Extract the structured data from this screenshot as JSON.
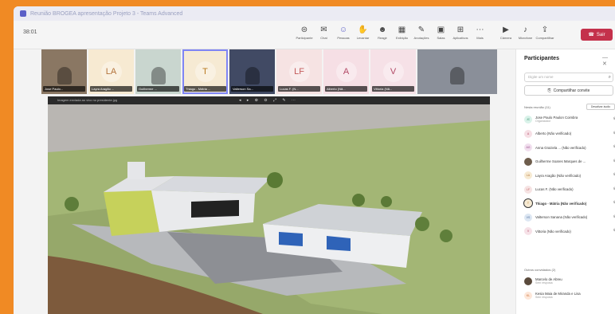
{
  "window": {
    "title": "Reunião BROGEA apresentação Projeto 3 - Teams Advanced"
  },
  "toolbar": {
    "timer": "38:01",
    "buttons": [
      {
        "label": "Participante",
        "icon": "participants-icon"
      },
      {
        "label": "Chat",
        "icon": "chat-icon"
      },
      {
        "label": "Pessoas",
        "icon": "people-icon"
      },
      {
        "label": "Levantar",
        "icon": "raise-hand-icon"
      },
      {
        "label": "Reagir",
        "icon": "react-icon"
      },
      {
        "label": "Exibição",
        "icon": "view-icon"
      },
      {
        "label": "Anotações",
        "icon": "notes-icon"
      },
      {
        "label": "Salas",
        "icon": "rooms-icon"
      },
      {
        "label": "Aplicativos",
        "icon": "apps-icon"
      },
      {
        "label": "Mais",
        "icon": "more-icon"
      },
      {
        "label": "Câmera",
        "icon": "camera-icon"
      },
      {
        "label": "Microfone",
        "icon": "mic-icon"
      },
      {
        "label": "Compartilhar",
        "icon": "share-icon"
      }
    ],
    "leave_label": "Sair"
  },
  "tiles": [
    {
      "name": "Jose Paulo...",
      "initials": "",
      "bg": "#8a7763",
      "color": "#333",
      "wide": false
    },
    {
      "name": "Layra Aragão ...",
      "initials": "LA",
      "bg": "#f7ead2",
      "color": "#b3743c",
      "wide": false
    },
    {
      "name": "Guilherme ...",
      "initials": "",
      "bg": "#c9d6cf",
      "color": "#333",
      "wide": false
    },
    {
      "name": "Thiago - Mátria ...",
      "initials": "T",
      "bg": "#f6ead3",
      "color": "#b97a20",
      "wide": false,
      "speaking": true
    },
    {
      "name": "Valterson Sa...",
      "initials": "",
      "bg": "#414a64",
      "color": "#fff",
      "wide": false
    },
    {
      "name": "Lucas F. (N...",
      "initials": "LF",
      "bg": "#f6e3e3",
      "color": "#c35a5a",
      "wide": false
    },
    {
      "name": "Alberto (Nã...",
      "initials": "A",
      "bg": "#f6dfe5",
      "color": "#b24a66",
      "wide": false
    },
    {
      "name": "Vittoria (Nã...",
      "initials": "V",
      "bg": "#f6e1e7",
      "color": "#b24a66",
      "wide": false
    },
    {
      "name": "",
      "initials": "",
      "bg": "#8a8f99",
      "color": "#333",
      "wide": true
    }
  ],
  "share": {
    "caption": "Imagem enviada ao vivo no presidente.jpg"
  },
  "panel": {
    "title": "Participantes",
    "invite_placeholder": "Digite um nome",
    "share_invite_label": "Compartilhar convite",
    "in_meeting_header": "Nesta reunião (11)",
    "mute_all_label": "Desativar áudio",
    "participants": [
      {
        "name": "Jose Paulo Paulon Coimbra",
        "sub": "Organizador",
        "initials": "JC",
        "bg": "#d9f2e9",
        "color": "#2b8a66"
      },
      {
        "name": "Alberto (Não verificado)",
        "sub": "",
        "initials": "A",
        "bg": "#f6dfe5",
        "color": "#b24a66"
      },
      {
        "name": "Anna Graziela ... (Não verificado)",
        "sub": "",
        "initials": "AG",
        "bg": "#f1dfee",
        "color": "#97488a"
      },
      {
        "name": "Guilherme Soares Marques de ...",
        "sub": "",
        "initials": "",
        "bg": "#6e5d4c",
        "color": "#fff"
      },
      {
        "name": "Layra Aragão (Não verificado)",
        "sub": "",
        "initials": "LA",
        "bg": "#f7ead2",
        "color": "#b3743c"
      },
      {
        "name": "Lucas F. (Não verificado)",
        "sub": "",
        "initials": "LF",
        "bg": "#f6e3e3",
        "color": "#c35a5a"
      },
      {
        "name": "Thiago - Mátria (Não verificado)",
        "sub": "",
        "initials": "T",
        "bg": "#f6ead3",
        "color": "#b97a20",
        "selected": true
      },
      {
        "name": "Valterson Sanana (Não verificado)",
        "sub": "",
        "initials": "VS",
        "bg": "#dde7f3",
        "color": "#4a6b9a"
      },
      {
        "name": "Vittoria (Não verificado)",
        "sub": "",
        "initials": "V",
        "bg": "#f6e1e7",
        "color": "#b24a66"
      }
    ],
    "invited_header": "Outros convidados (2)",
    "invited": [
      {
        "name": "Marcelo de Abreu",
        "sub": "Sem resposta",
        "initials": "",
        "bg": "#5a4a3c",
        "color": "#fff"
      },
      {
        "name": "Kesia Maia de Miranda e Lisa",
        "sub": "Sem resposta",
        "initials": "KL",
        "bg": "#fde7d9",
        "color": "#c86a2c"
      }
    ]
  },
  "colors": {
    "frame": "#f08a24",
    "accent": "#5b5fc7",
    "leave": "#c4314b"
  }
}
